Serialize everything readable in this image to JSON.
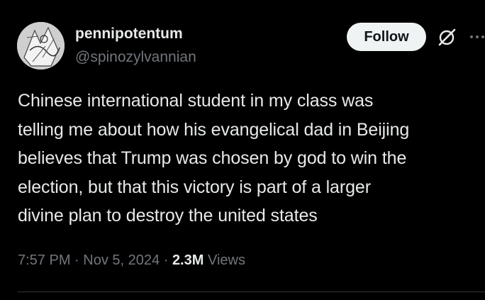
{
  "author": {
    "display_name": "pennipotentum",
    "handle": "@spinozylvannian"
  },
  "actions": {
    "follow_label": "Follow",
    "grok_icon": "grok-icon",
    "more_icon": "more-icon"
  },
  "tweet": {
    "text": "Chinese international student in my class was\ntelling me about how his evangelical dad in Beijing\nbelieves that Trump was chosen by god to win the\nelection, but that this victory is part of a larger\ndivine plan to destroy the united states",
    "time": "7:57 PM",
    "separator": "·",
    "date": "Nov 5, 2024",
    "views_count": "2.3M",
    "views_label": "Views"
  },
  "colors": {
    "background": "#000000",
    "primary_text": "#e7e9ea",
    "secondary_text": "#71767b",
    "follow_bg": "#eff3f4",
    "divider": "#2f3336"
  }
}
